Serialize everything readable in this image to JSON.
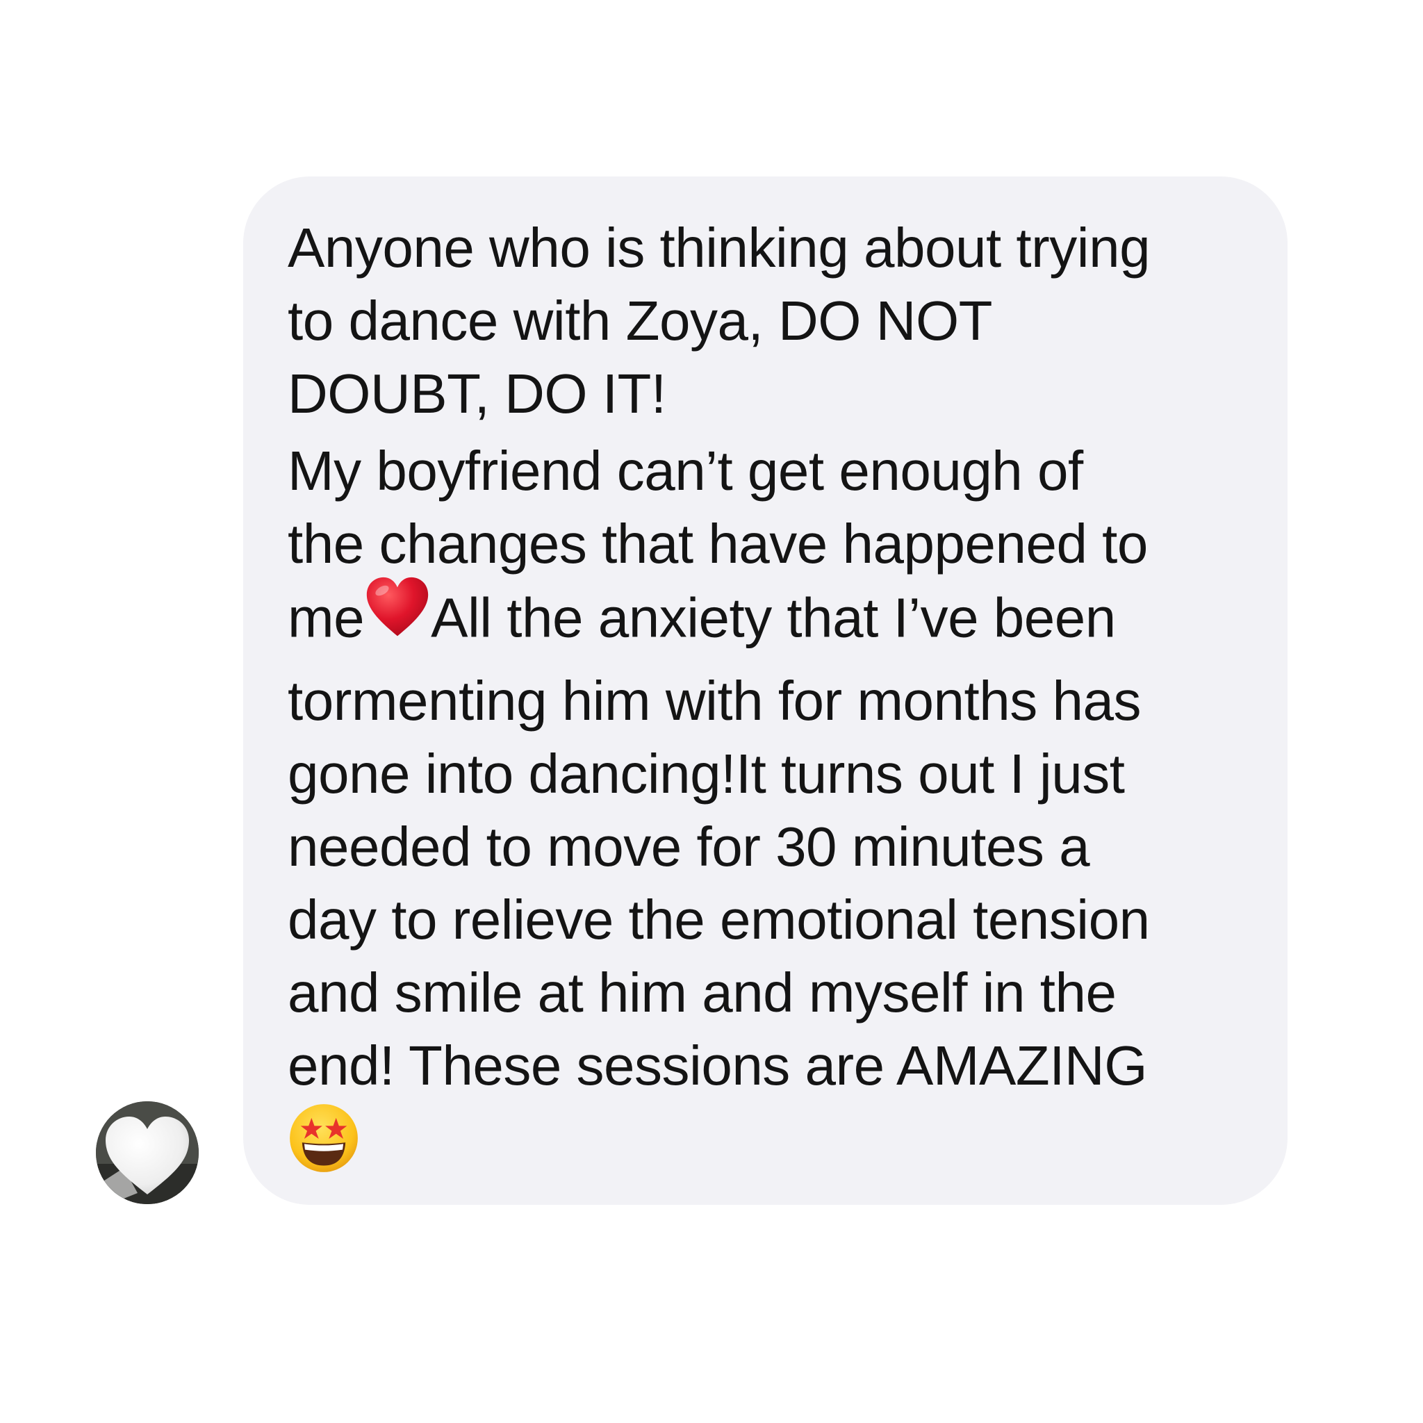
{
  "message": {
    "paragraph1": [
      "Anyone who is thinking about trying",
      "to dance with Zoya, DO NOT",
      "DOUBT, DO IT!"
    ],
    "paragraph2": {
      "line1": "My boyfriend can’t get enough of",
      "line2": "the changes that have happened to",
      "line3_before_emoji": "me",
      "line3_after_emoji": "All the anxiety that I’ve been",
      "lines_rest": [
        "tormenting him with for months has",
        "gone into dancing!It turns out I just",
        "needed to move for 30 minutes a",
        "day to relieve the emotional tension",
        "and smile at him and myself in the",
        "end! These sessions are AMAZING"
      ],
      "inline_emoji": "red-heart-icon",
      "final_emoji": "star-struck-face-icon"
    }
  },
  "sender": {
    "avatar_icon": "white-heart-icon"
  },
  "colors": {
    "bubble_background": "#f2f2f6",
    "text": "#141414",
    "heart_red": "#e0152b",
    "emoji_yellow": "#fcc21b"
  }
}
